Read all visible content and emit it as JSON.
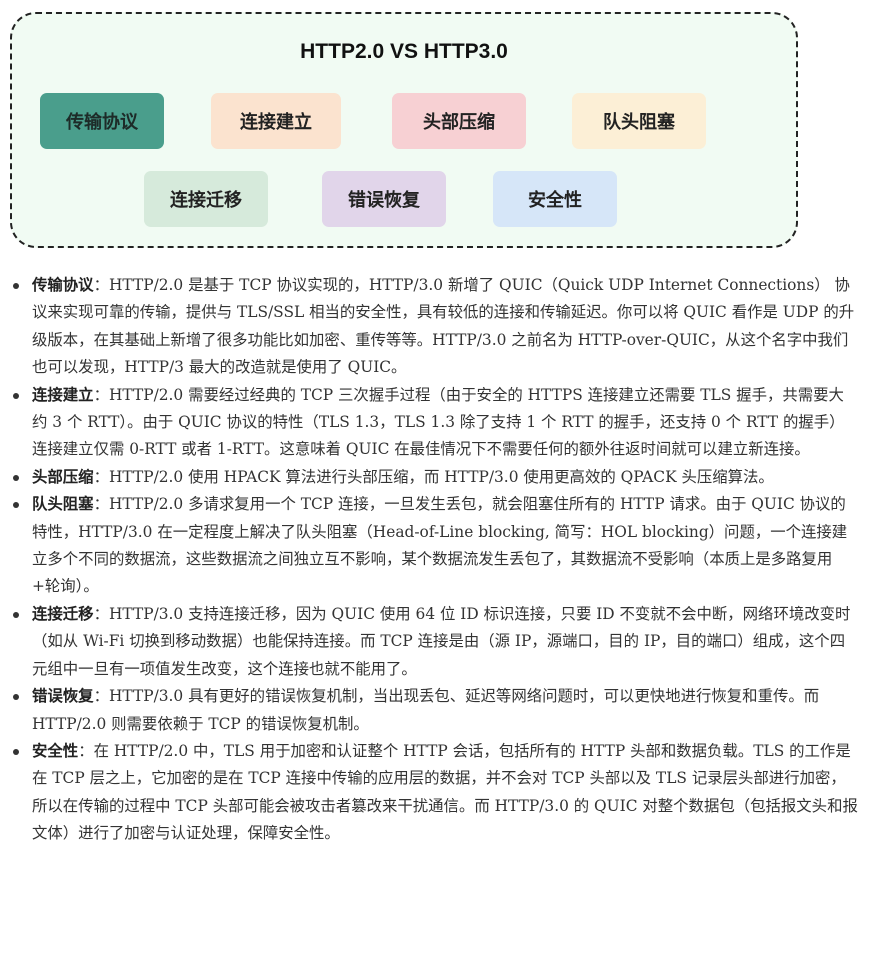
{
  "diagram": {
    "title": "HTTP2.0 VS HTTP3.0",
    "boxes": [
      {
        "label": "传输协议",
        "bg": "#4a9e8c",
        "color": "#1d2b28"
      },
      {
        "label": "连接建立",
        "bg": "#fbe3cf",
        "color": "#222222"
      },
      {
        "label": "头部压缩",
        "bg": "#f7d0d3",
        "color": "#222222"
      },
      {
        "label": "队头阻塞",
        "bg": "#fcefd6",
        "color": "#222222"
      },
      {
        "label": "连接迁移",
        "bg": "#d6eadb",
        "color": "#222222"
      },
      {
        "label": "错误恢复",
        "bg": "#e1d5ea",
        "color": "#222222"
      },
      {
        "label": "安全性",
        "bg": "#d6e6f8",
        "color": "#222222"
      }
    ]
  },
  "items": [
    {
      "term": "传输协议",
      "text": "：HTTP/2.0 是基于 TCP 协议实现的，HTTP/3.0 新增了 QUIC（Quick UDP Internet Connections） 协议来实现可靠的传输，提供与 TLS/SSL 相当的安全性，具有较低的连接和传输延迟。你可以将 QUIC 看作是 UDP 的升级版本，在其基础上新增了很多功能比如加密、重传等等。HTTP/3.0 之前名为 HTTP-over-QUIC，从这个名字中我们也可以发现，HTTP/3 最大的改造就是使用了 QUIC。"
    },
    {
      "term": "连接建立",
      "text": "：HTTP/2.0 需要经过经典的 TCP 三次握手过程（由于安全的 HTTPS 连接建立还需要 TLS 握手，共需要大约 3 个 RTT）。由于 QUIC 协议的特性（TLS 1.3，TLS 1.3 除了支持 1 个 RTT 的握手，还支持 0 个 RTT 的握手）连接建立仅需 0-RTT 或者 1-RTT。这意味着 QUIC 在最佳情况下不需要任何的额外往返时间就可以建立新连接。"
    },
    {
      "term": "头部压缩",
      "text": "：HTTP/2.0 使用 HPACK 算法进行头部压缩，而 HTTP/3.0 使用更高效的 QPACK 头压缩算法。"
    },
    {
      "term": "队头阻塞",
      "text": "：HTTP/2.0 多请求复用一个 TCP 连接，一旦发生丢包，就会阻塞住所有的 HTTP 请求。由于 QUIC 协议的特性，HTTP/3.0 在一定程度上解决了队头阻塞（Head-of-Line blocking, 简写：HOL blocking）问题，一个连接建立多个不同的数据流，这些数据流之间独立互不影响，某个数据流发生丢包了，其数据流不受影响（本质上是多路复用+轮询）。"
    },
    {
      "term": "连接迁移",
      "text": "：HTTP/3.0 支持连接迁移，因为 QUIC 使用 64 位 ID 标识连接，只要 ID 不变就不会中断，网络环境改变时（如从 Wi-Fi 切换到移动数据）也能保持连接。而 TCP 连接是由（源 IP，源端口，目的 IP，目的端口）组成，这个四元组中一旦有一项值发生改变，这个连接也就不能用了。"
    },
    {
      "term": "错误恢复",
      "text": "：HTTP/3.0 具有更好的错误恢复机制，当出现丢包、延迟等网络问题时，可以更快地进行恢复和重传。而 HTTP/2.0 则需要依赖于 TCP 的错误恢复机制。"
    },
    {
      "term": "安全性",
      "text": "：在 HTTP/2.0 中，TLS 用于加密和认证整个 HTTP 会话，包括所有的 HTTP 头部和数据负载。TLS 的工作是在 TCP 层之上，它加密的是在 TCP 连接中传输的应用层的数据，并不会对 TCP 头部以及 TLS 记录层头部进行加密，所以在传输的过程中 TCP 头部可能会被攻击者篡改来干扰通信。而 HTTP/3.0 的 QUIC 对整个数据包（包括报文头和报文体）进行了加密与认证处理，保障安全性。"
    }
  ]
}
